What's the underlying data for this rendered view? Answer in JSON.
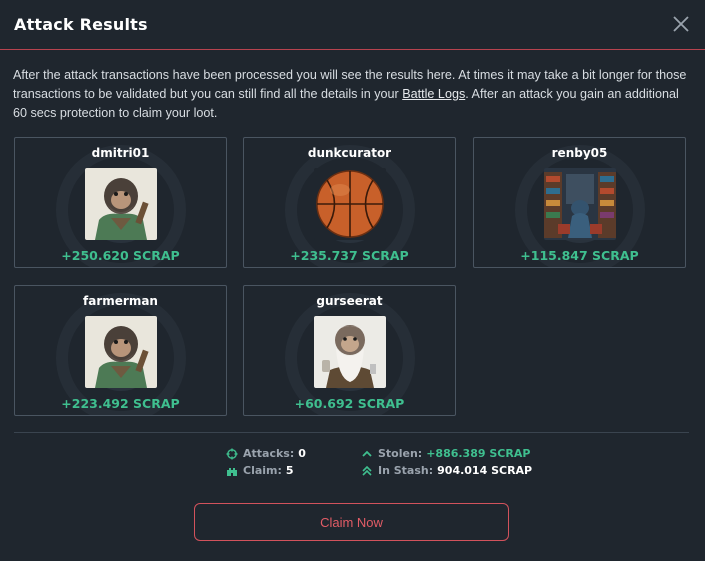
{
  "modal": {
    "title": "Attack Results",
    "intro_before": "After the attack transactions have been processed you will see the results here. At times it may take a bit longer for those transactions to be validated but you can still find all the details in your ",
    "intro_link": "Battle Logs",
    "intro_after": ". After an attack you gain an additional 60 secs protection to claim your loot."
  },
  "results": [
    {
      "name": "dmitri01",
      "amount": "+250.620 SCRAP",
      "avatar": "monkey-green-jacket"
    },
    {
      "name": "dunkcurator",
      "amount": "+235.737 SCRAP",
      "avatar": "basketball"
    },
    {
      "name": "renby05",
      "amount": "+115.847 SCRAP",
      "avatar": "library-robot"
    },
    {
      "name": "farmerman",
      "amount": "+223.492 SCRAP",
      "avatar": "monkey-green-jacket"
    },
    {
      "name": "gurseerat",
      "amount": "+60.692 SCRAP",
      "avatar": "monkey-white-beard"
    }
  ],
  "stats": {
    "attacks_label": "Attacks:",
    "attacks_value": "0",
    "claim_label": "Claim:",
    "claim_value": "5",
    "stolen_label": "Stolen:",
    "stolen_value": "+886.389 SCRAP",
    "stash_label": "In Stash:",
    "stash_value": "904.014 SCRAP"
  },
  "claim_button": "Claim Now",
  "colors": {
    "accent": "#d2525c",
    "positive": "#3fbf8f",
    "background": "#1f262e"
  }
}
